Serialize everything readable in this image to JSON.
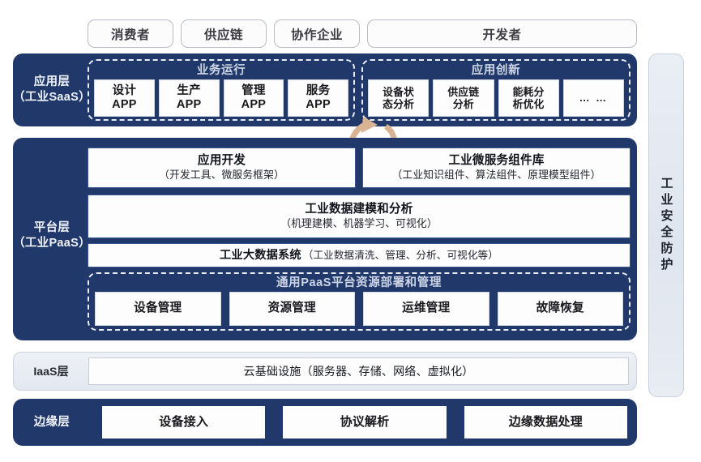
{
  "stakeholders": [
    {
      "label": "消费者",
      "size": "sm"
    },
    {
      "label": "供应链",
      "size": "sm"
    },
    {
      "label": "协作企业",
      "size": "sm"
    },
    {
      "label": "开发者",
      "size": "dev"
    }
  ],
  "application_layer": {
    "label_line1": "应用层",
    "label_line2": "（工业SaaS）",
    "groups": [
      {
        "title": "业务运行",
        "cells": [
          {
            "line1": "设计",
            "line2": "APP"
          },
          {
            "line1": "生产",
            "line2": "APP"
          },
          {
            "line1": "管理",
            "line2": "APP"
          },
          {
            "line1": "服务",
            "line2": "APP"
          }
        ]
      },
      {
        "title": "应用创新",
        "cells": [
          {
            "line1": "设备状",
            "line2": "态分析"
          },
          {
            "line1": "供应链",
            "line2": "分析"
          },
          {
            "line1": "能耗分",
            "line2": "析优化"
          },
          {
            "line1": "… …",
            "line2": ""
          }
        ]
      }
    ],
    "cycle_arrow_color": "#d8b494"
  },
  "platform_layer": {
    "label_line1": "平台层",
    "label_line2": "（工业PaaS）",
    "app_dev": {
      "title": "应用开发",
      "subtitle": "（开发工具、微服务框架）"
    },
    "microservice": {
      "title": "工业微服务组件库",
      "subtitle": "（工业知识组件、算法组件、原理模型组件）"
    },
    "modeling": {
      "title": "工业数据建模和分析",
      "subtitle": "（机理建模、机器学习、可视化）"
    },
    "bigdata": {
      "title": "工业大数据系统",
      "subtitle": "（工业数据清洗、管理、分析、可视化等）"
    },
    "paas_group": {
      "title": "通用PaaS平台资源部署和管理",
      "cells": [
        "设备管理",
        "资源管理",
        "运维管理",
        "故障恢复"
      ]
    }
  },
  "iaas_layer": {
    "label": "IaaS层",
    "content": "云基础设施（服务器、存储、网络、虚拟化）"
  },
  "edge_layer": {
    "label": "边缘层",
    "cells": [
      "设备接入",
      "协议解析",
      "边缘数据处理"
    ]
  },
  "security_bar": {
    "text": "工业安全防护"
  },
  "colors": {
    "panel_navy": "#21386a",
    "panel_border": "#3a5690",
    "dashed_border": "#e8ecf4",
    "arrow_tan": "#d8b494"
  }
}
